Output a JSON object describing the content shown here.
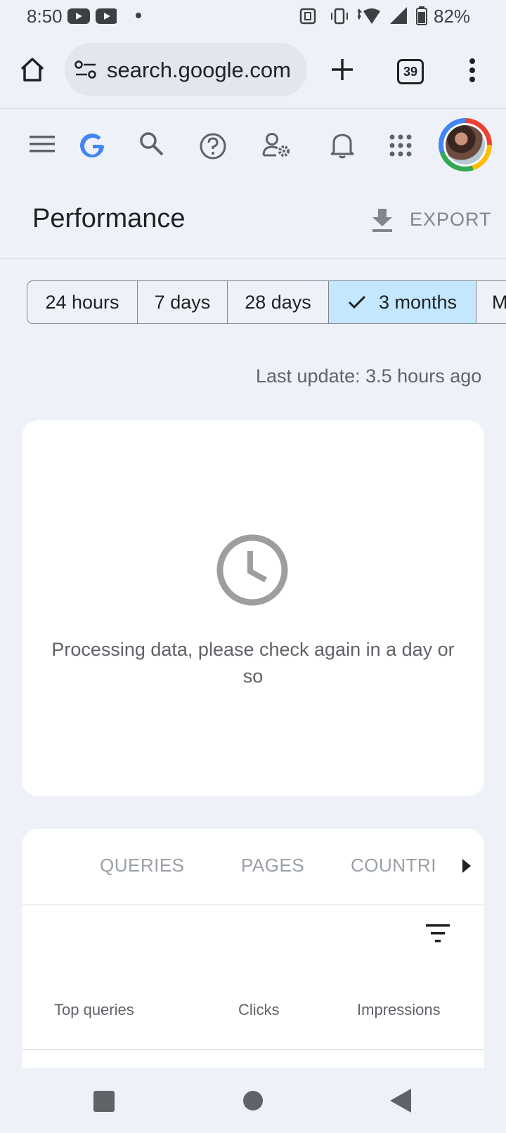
{
  "status_bar": {
    "time": "8:50",
    "battery": "82%"
  },
  "browser": {
    "url": "search.google.com",
    "tab_count": "39"
  },
  "page": {
    "title": "Performance",
    "export_label": "EXPORT"
  },
  "date_range": {
    "options": [
      "24 hours",
      "7 days",
      "28 days",
      "3 months",
      "M"
    ],
    "selected": "3 months"
  },
  "last_update": "Last update: 3.5 hours ago",
  "processing": {
    "message": "Processing data, please check again in a day or so"
  },
  "tabs": [
    "QUERIES",
    "PAGES",
    "COUNTRII"
  ],
  "table": {
    "columns": [
      "Top queries",
      "Clicks",
      "Impressions"
    ]
  },
  "colors": {
    "selected_chip": "#c2e7ff",
    "google_blue": "#4285f4",
    "muted": "#80868b"
  }
}
